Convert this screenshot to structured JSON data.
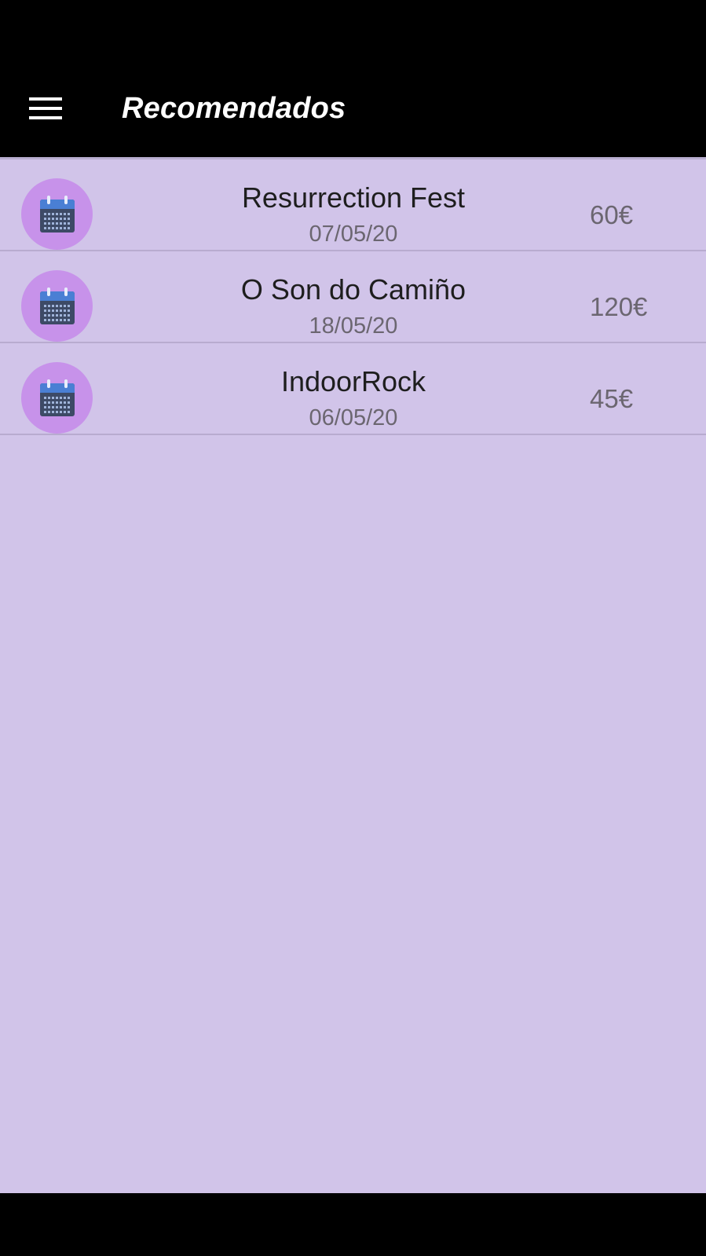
{
  "app_bar": {
    "title": "Recomendados",
    "menu_icon": "hamburger-menu-icon"
  },
  "events": [
    {
      "name": "Resurrection Fest",
      "date": "07/05/20",
      "price": "60€",
      "icon": "calendar-icon"
    },
    {
      "name": "O Son do Camiño",
      "date": "18/05/20",
      "price": "120€",
      "icon": "calendar-icon"
    },
    {
      "name": "IndoorRock",
      "date": "06/05/20",
      "price": "45€",
      "icon": "calendar-icon"
    }
  ],
  "colors": {
    "background": "#d1c4e9",
    "app_bar": "#000000",
    "icon_circle": "#c792ea",
    "calendar_header": "#4a7fd4",
    "calendar_body": "#3d4a66"
  }
}
